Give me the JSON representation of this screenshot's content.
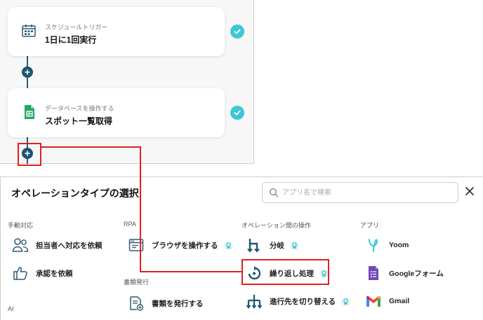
{
  "flow": {
    "steps": [
      {
        "sub": "スケジュールトリガー",
        "title": "1日に1回実行",
        "icon": "calendar-icon"
      },
      {
        "sub": "データベースを操作する",
        "title": "スポット一覧取得",
        "icon": "google-sheets-icon"
      }
    ]
  },
  "panel": {
    "title": "オペレーションタイプの選択",
    "search_placeholder": "アプリ名で検索",
    "categories": {
      "manual": "手動対応",
      "ai": "AI",
      "rpa": "RPA",
      "docs": "書類発行",
      "ops": "オペレーション間の操作",
      "apps": "アプリ"
    },
    "manual_items": [
      {
        "label": "担当者へ対応を依頼",
        "icon": "people-icon"
      },
      {
        "label": "承認を依頼",
        "icon": "thumbs-up-icon"
      }
    ],
    "rpa_items": [
      {
        "label": "ブラウザを操作する",
        "icon": "browser-icon",
        "badge": "premium-badge-icon"
      }
    ],
    "doc_items": [
      {
        "label": "書類を発行する",
        "icon": "document-add-icon"
      }
    ],
    "op_items": [
      {
        "label": "分岐",
        "icon": "branch-icon",
        "badge": "premium-badge-icon"
      },
      {
        "label": "繰り返し処理",
        "icon": "loop-icon",
        "badge": "premium-badge-icon"
      },
      {
        "label": "進行先を切り替える",
        "icon": "route-switch-icon",
        "badge": "premium-badge-icon"
      }
    ],
    "app_items": [
      {
        "label": "Yoom",
        "icon": "yoom-icon"
      },
      {
        "label": "Googleフォーム",
        "icon": "google-forms-icon"
      },
      {
        "label": "Gmail",
        "icon": "gmail-icon"
      }
    ]
  },
  "colors": {
    "accent_teal": "#3cc7d7",
    "flow_node": "#1f5570",
    "annotation_red": "#e02020"
  }
}
